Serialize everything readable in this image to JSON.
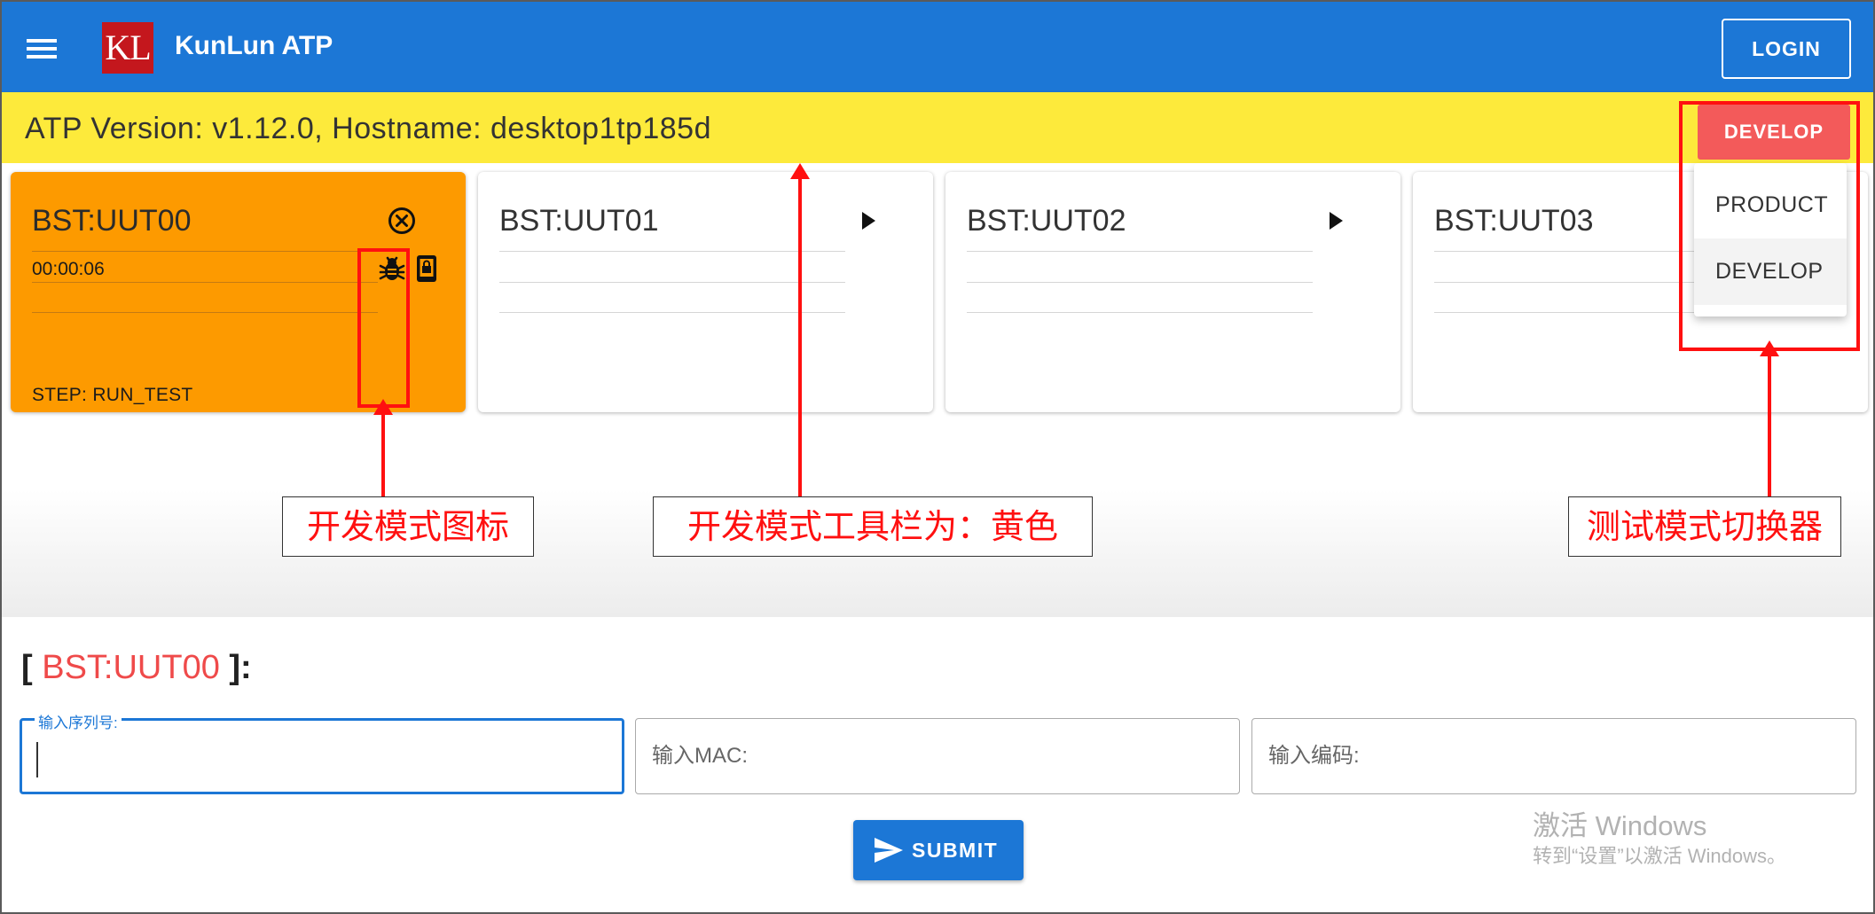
{
  "app": {
    "logo_text": "KL",
    "title": "KunLun ATP",
    "login_label": "LOGIN"
  },
  "toolbar": {
    "version_text": "ATP Version: v1.12.0, Hostname: desktop1tp185d",
    "mode_button_label": "DEVELOP",
    "color": "#fdea3b"
  },
  "mode_menu": {
    "items": [
      {
        "label": "PRODUCT",
        "selected": false
      },
      {
        "label": "DEVELOP",
        "selected": true
      }
    ]
  },
  "cards": [
    {
      "title": "BST:UUT00",
      "timer": "00:00:06",
      "step": "STEP: RUN_TEST",
      "active": true,
      "action_icon": "close-circle-icon",
      "status_icons": [
        "bug-icon",
        "lock-device-icon"
      ]
    },
    {
      "title": "BST:UUT01",
      "timer": "",
      "step": "",
      "active": false,
      "action_icon": "play-icon"
    },
    {
      "title": "BST:UUT02",
      "timer": "",
      "step": "",
      "active": false,
      "action_icon": "play-icon"
    },
    {
      "title": "BST:UUT03",
      "timer": "",
      "step": "",
      "active": false,
      "action_icon": "play-icon"
    }
  ],
  "annotations": {
    "dev_icon_label": "开发模式图标",
    "toolbar_label": "开发模式工具栏为：黄色",
    "switcher_label": "测试模式切换器"
  },
  "form": {
    "open_bracket": "[",
    "selected_unit": "BST:UUT00",
    "close_bracket": "]:",
    "serial_label": "输入序列号:",
    "serial_value": "",
    "mac_placeholder": "输入MAC:",
    "code_placeholder": "输入编码:",
    "submit_label": "SUBMIT"
  },
  "watermark": {
    "title": "激活 Windows",
    "subtitle": "转到“设置”以激活 Windows。"
  },
  "colors": {
    "primary": "#1c77d6",
    "active_card": "#fd9a00",
    "develop": "#f35a5a",
    "annotation": "#ff1010"
  }
}
